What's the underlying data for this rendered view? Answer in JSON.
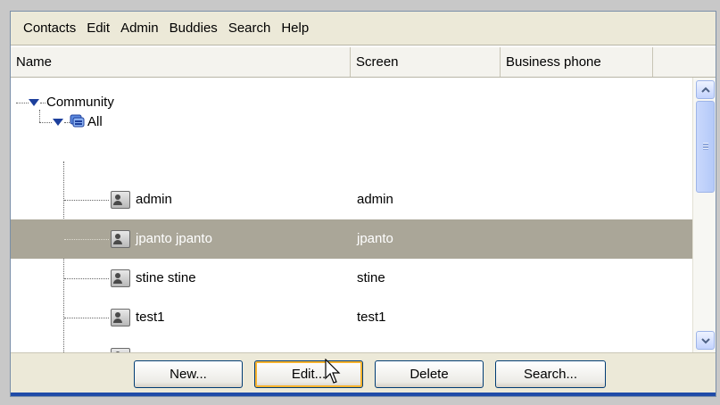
{
  "menu": [
    "Contacts",
    "Edit",
    "Admin",
    "Buddies",
    "Search",
    "Help"
  ],
  "columns": {
    "name": "Name",
    "screen": "Screen",
    "phone": "Business phone"
  },
  "tree": {
    "root": "Community",
    "group": "All",
    "rows": [
      {
        "name": "admin",
        "screen": "admin",
        "selected": false
      },
      {
        "name": "jpanto jpanto",
        "screen": "jpanto",
        "selected": true
      },
      {
        "name": "stine stine",
        "screen": "stine",
        "selected": false
      },
      {
        "name": "test1",
        "screen": "test1",
        "selected": false
      }
    ]
  },
  "buttons": {
    "new": "New...",
    "edit": "Edit...",
    "delete": "Delete",
    "search": "Search..."
  },
  "colors": {
    "selection": "#aaa698",
    "button_border": "#003c74",
    "accent_blue": "#1f4ba8"
  }
}
